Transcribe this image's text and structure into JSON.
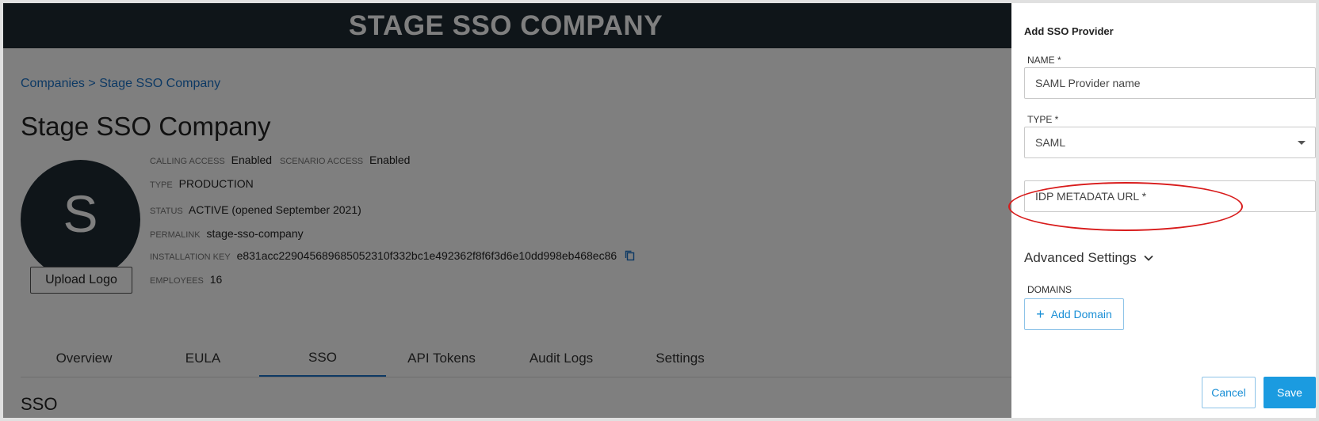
{
  "header": {
    "title": "STAGE SSO COMPANY"
  },
  "breadcrumb": {
    "parent": "Companies",
    "separator": ">",
    "current": "Stage SSO Company"
  },
  "company": {
    "name": "Stage SSO Company",
    "avatar_letter": "S",
    "upload_logo_label": "Upload Logo",
    "calling_access": {
      "label": "CALLING ACCESS",
      "value": "Enabled"
    },
    "scenario_access": {
      "label": "SCENARIO ACCESS",
      "value": "Enabled"
    },
    "type": {
      "label": "TYPE",
      "value": "PRODUCTION"
    },
    "status": {
      "label": "STATUS",
      "value": "ACTIVE (opened September 2021)"
    },
    "permalink": {
      "label": "PERMALINK",
      "value": "stage-sso-company"
    },
    "installation_key": {
      "label": "INSTALLATION KEY",
      "value": "e831acc229045689685052310f332bc1e492362f8f6f3d6e10dd998eb468ec86"
    },
    "employees": {
      "label": "EMPLOYEES",
      "value": "16"
    }
  },
  "tabs": [
    {
      "label": "Overview"
    },
    {
      "label": "EULA"
    },
    {
      "label": "SSO"
    },
    {
      "label": "API Tokens"
    },
    {
      "label": "Audit Logs"
    },
    {
      "label": "Settings"
    }
  ],
  "active_tab": "SSO",
  "section_title": "SSO",
  "drawer": {
    "title": "Add SSO Provider",
    "name_label": "NAME *",
    "name_placeholder": "SAML Provider name",
    "type_label": "TYPE *",
    "type_value": "SAML",
    "idp_placeholder": "IDP METADATA URL *",
    "advanced_label": "Advanced Settings",
    "domains_label": "DOMAINS",
    "add_domain_label": "Add Domain",
    "cancel_label": "Cancel",
    "save_label": "Save"
  },
  "colors": {
    "header_bg": "#1f2a33",
    "link": "#1a73c8",
    "primary": "#1b9be0",
    "highlight": "#d81b1b"
  },
  "icons": {
    "copy": "copy-icon",
    "chevron": "chevron-down-icon",
    "plus": "plus-icon",
    "caret": "caret-down-icon"
  }
}
